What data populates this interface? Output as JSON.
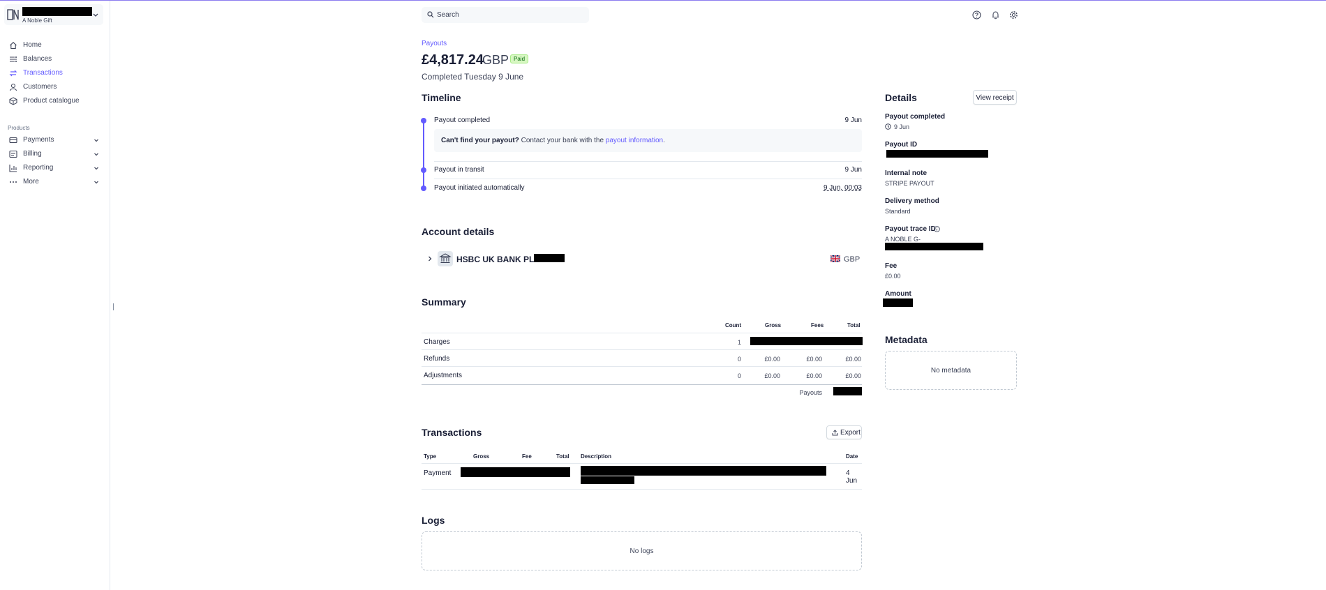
{
  "sidebar": {
    "account_sub": "A Noble Gift",
    "nav": [
      {
        "label": "Home",
        "icon": "home-icon"
      },
      {
        "label": "Balances",
        "icon": "balances-icon"
      },
      {
        "label": "Transactions",
        "icon": "transactions-icon"
      },
      {
        "label": "Customers",
        "icon": "customers-icon"
      },
      {
        "label": "Product catalogue",
        "icon": "product-catalogue-icon"
      }
    ],
    "products_label": "Products",
    "products": [
      {
        "label": "Payments",
        "icon": "payments-icon"
      },
      {
        "label": "Billing",
        "icon": "billing-icon"
      },
      {
        "label": "Reporting",
        "icon": "reporting-icon"
      },
      {
        "label": "More",
        "icon": "more-icon"
      }
    ],
    "active_item": "Transactions"
  },
  "header": {
    "search_placeholder": "Search",
    "icons": [
      "help-icon",
      "bell-icon",
      "gear-icon"
    ]
  },
  "payout": {
    "breadcrumb": "Payouts",
    "amount": "£4,817.24",
    "currency": "GBP",
    "status": "Paid",
    "completed": "Completed Tuesday 9 June"
  },
  "timeline": {
    "title": "Timeline",
    "events": [
      {
        "label": "Payout completed",
        "date": "9 Jun"
      },
      {
        "label": "Payout in transit",
        "date": "9 Jun"
      },
      {
        "label": "Payout initiated automatically",
        "date": "9 Jun, 00:03"
      }
    ],
    "note_bold": "Can't find your payout?",
    "note_text": " Contact your bank with the ",
    "note_link": "payout information",
    "note_end": "."
  },
  "account_details": {
    "title": "Account details",
    "bank_name": "HSBC UK BANK PLC",
    "currency": "GBP"
  },
  "summary": {
    "title": "Summary",
    "columns": [
      "Count",
      "Gross",
      "Fees",
      "Total"
    ],
    "rows": [
      {
        "label": "Charges",
        "count": "1",
        "gross": "",
        "fees": "",
        "total": ""
      },
      {
        "label": "Refunds",
        "count": "0",
        "gross": "£0.00",
        "fees": "£0.00",
        "total": "£0.00"
      },
      {
        "label": "Adjustments",
        "count": "0",
        "gross": "£0.00",
        "fees": "£0.00",
        "total": "£0.00"
      }
    ],
    "payouts_label": "Payouts"
  },
  "transactions": {
    "title": "Transactions",
    "export_label": "Export",
    "columns": [
      "Type",
      "Gross",
      "Fee",
      "Total",
      "Description",
      "Date"
    ],
    "rows": [
      {
        "type": "Payment",
        "date": "4 Jun"
      }
    ]
  },
  "logs": {
    "title": "Logs",
    "empty": "No logs"
  },
  "details": {
    "title": "Details",
    "view_receipt": "View receipt",
    "payout_completed_label": "Payout completed",
    "payout_completed_value": "9 Jun",
    "payout_id_label": "Payout ID",
    "internal_note_label": "Internal note",
    "internal_note_value": "STRIPE PAYOUT",
    "delivery_method_label": "Delivery method",
    "delivery_method_value": "Standard",
    "trace_id_label": "Payout trace ID",
    "trace_id_value": "A NOBLE G-",
    "fee_label": "Fee",
    "fee_value": "£0.00",
    "amount_label": "Amount"
  },
  "metadata": {
    "title": "Metadata",
    "empty": "No metadata"
  },
  "colors": {
    "accent": "#635bff",
    "text": "#1a1f36",
    "paid_bg": "#d7f7c2",
    "paid_text": "#05690d"
  }
}
